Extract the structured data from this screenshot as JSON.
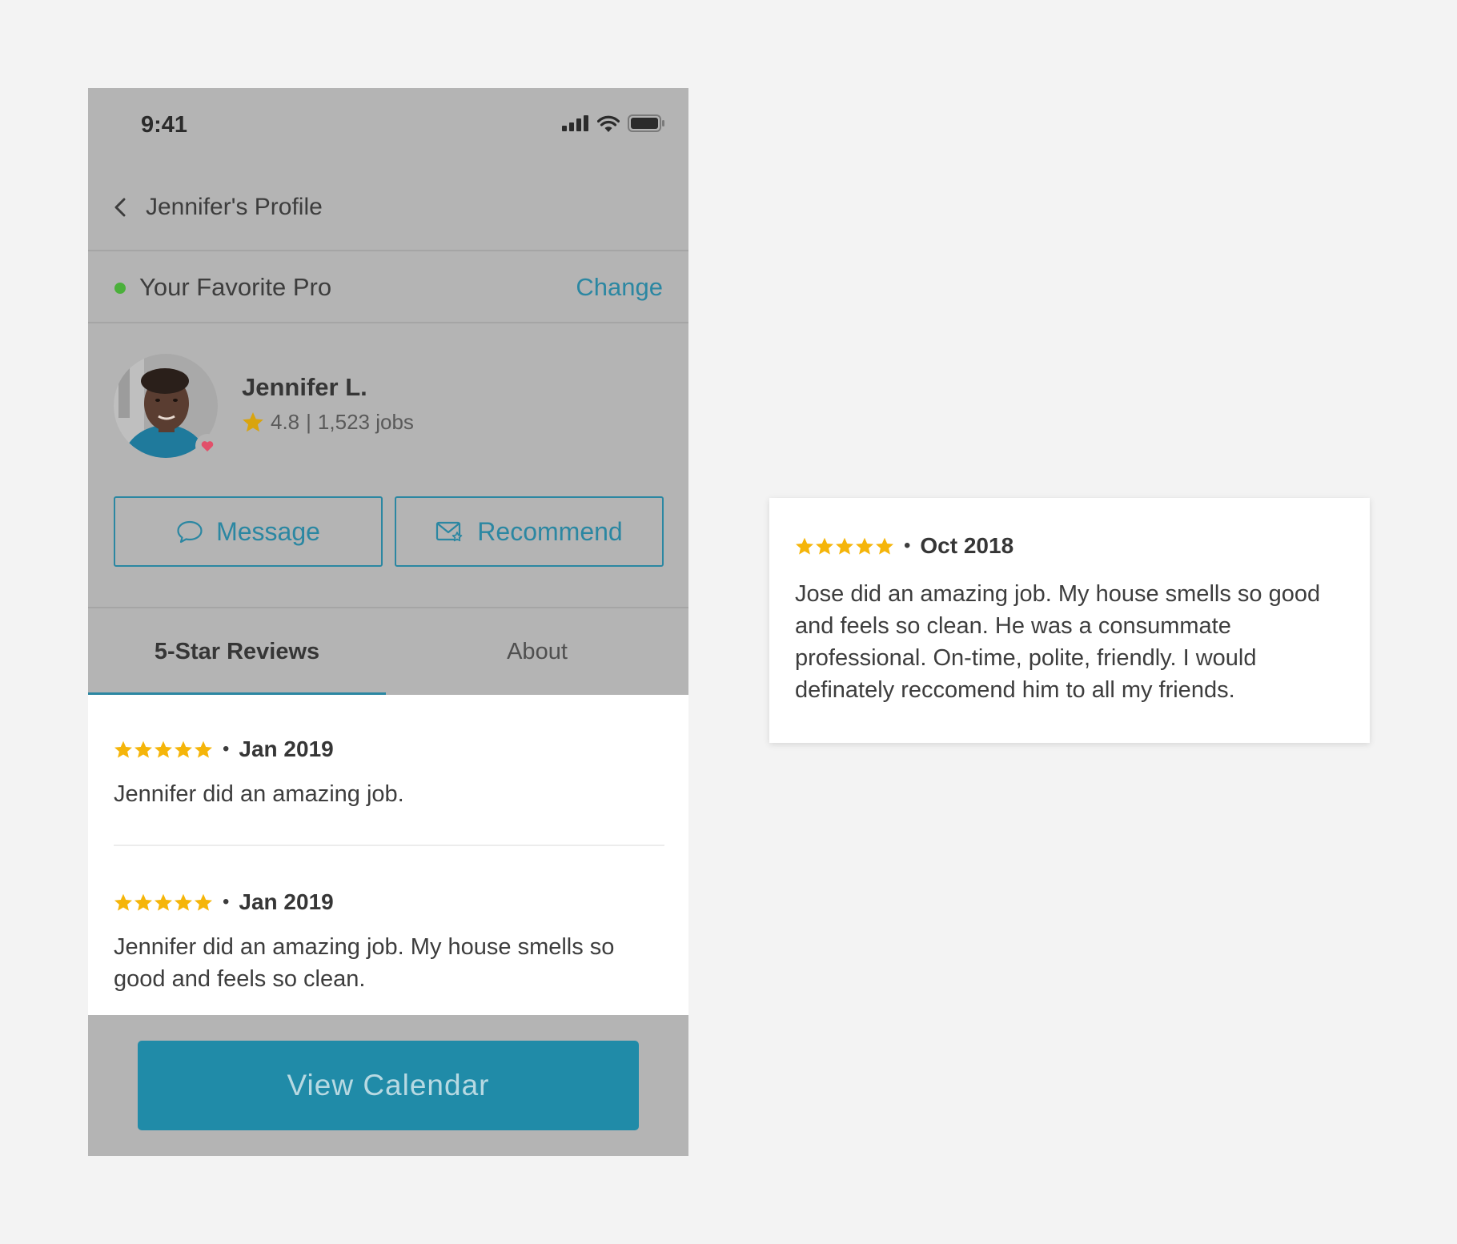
{
  "status_bar": {
    "time": "9:41"
  },
  "nav": {
    "title": "Jennifer's Profile"
  },
  "favorite": {
    "label": "Your Favorite Pro",
    "change_label": "Change",
    "status_color": "#4bb03b"
  },
  "pro": {
    "name": "Jennifer L.",
    "rating": "4.8",
    "separator": "|",
    "jobs": "1,523 jobs"
  },
  "actions": {
    "message_label": "Message",
    "recommend_label": "Recommend"
  },
  "tabs": [
    {
      "label": "5-Star Reviews",
      "active": true
    },
    {
      "label": "About",
      "active": false
    }
  ],
  "reviews": [
    {
      "stars": 5,
      "date": "Jan 2019",
      "text": "Jennifer did an amazing job."
    },
    {
      "stars": 5,
      "date": "Jan 2019",
      "text": "Jennifer did an amazing job. My house smells so good and feels so clean."
    }
  ],
  "cta": {
    "label": "View Calendar"
  },
  "detail_card": {
    "stars": 5,
    "date": "Oct 2018",
    "text": "Jose did an amazing job. My house smells so good and feels so clean. He was a consummate professional. On-time, polite, friendly. I would definately reccomend him to all my friends."
  },
  "bullet": "•",
  "colors": {
    "accent": "#2b87a2",
    "cta": "#208ba8",
    "star": "#f5b50a",
    "heart": "#e2506a"
  }
}
